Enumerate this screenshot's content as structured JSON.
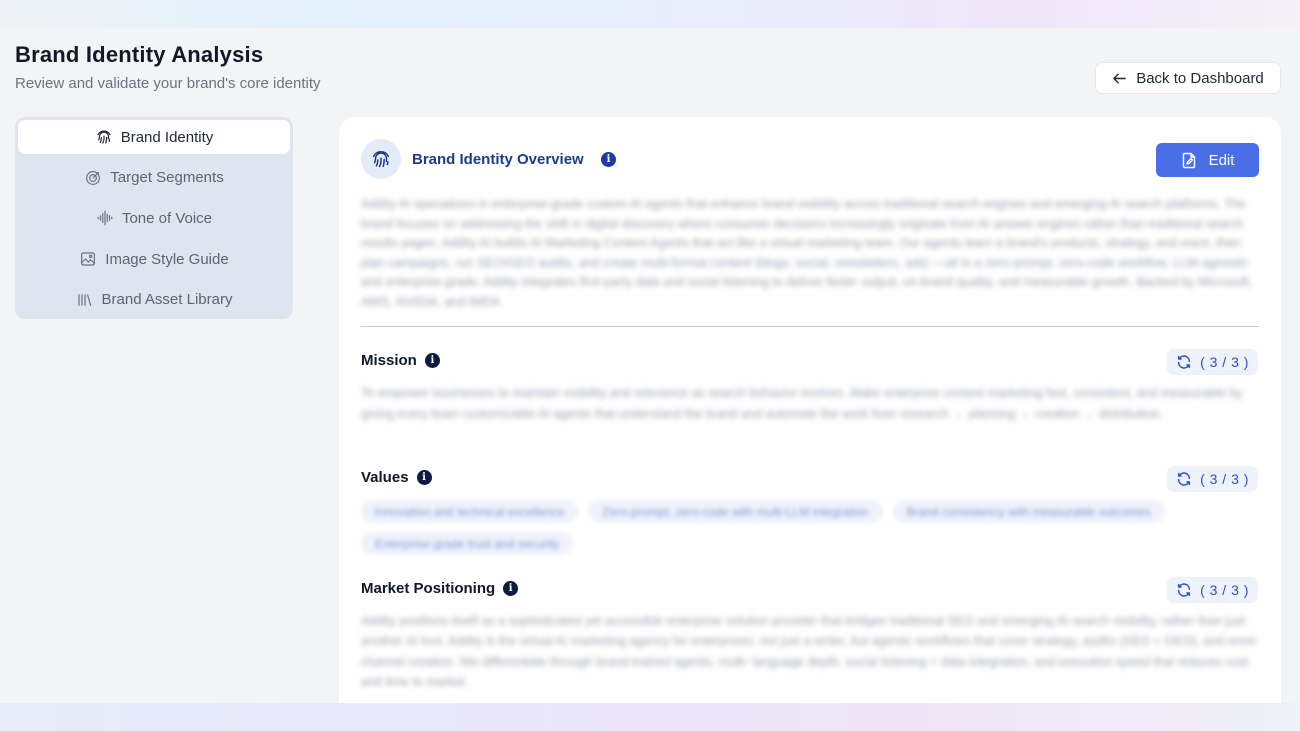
{
  "header": {
    "title": "Brand Identity Analysis",
    "subtitle": "Review and validate your brand's core identity",
    "back_label": "Back to Dashboard"
  },
  "sidebar": {
    "items": [
      {
        "label": "Brand Identity",
        "icon": "fingerprint-icon",
        "active": true
      },
      {
        "label": "Target Segments",
        "icon": "target-icon",
        "active": false
      },
      {
        "label": "Tone of Voice",
        "icon": "audio-wave-icon",
        "active": false
      },
      {
        "label": "Image Style Guide",
        "icon": "image-icon",
        "active": false
      },
      {
        "label": "Brand Asset Library",
        "icon": "library-icon",
        "active": false
      }
    ]
  },
  "overview": {
    "title": "Brand Identity Overview",
    "edit_label": "Edit",
    "text": "Addity AI specializes in enterprise-grade custom AI agents that enhance brand visibility across traditional search engines and emerging AI search platforms. The brand focuses on addressing the shift in digital discovery where consumer decisions increasingly originate from AI answer engines rather than traditional search results pages. Addity AI builds AI Marketing Content Agents that act like a virtual marketing team. Our agents learn a brand's products, strategy, and voice, then plan campaigns, run SEO/GEO audits, and create multi-format content (blogs, social, newsletters, ads) —all in a zero-prompt, zero-code workflow. LLM-agnostic and enterprise-grade, Addity integrates first-party data and social listening to deliver faster output, on-brand quality, and measurable growth. Backed by Microsoft, AWS, NVIDIA, and IMDA"
  },
  "sections": {
    "mission": {
      "title": "Mission",
      "counter": "( 3 / 3 )",
      "text": "To empower businesses to maintain visibility and relevance as search behavior evolves. Make enterprise content marketing fast, consistent, and measurable by giving every team customizable AI agents that understand the brand and automate the work from research → planning → creation → distribution."
    },
    "values": {
      "title": "Values",
      "counter": "( 3 / 3 )",
      "pills": [
        "Innovation and technical excellence",
        "Zero-prompt, zero-code with multi-LLM integration",
        "Brand consistency with measurable outcomes",
        "Enterprise-grade trust and security"
      ]
    },
    "positioning": {
      "title": "Market Positioning",
      "counter": "( 3 / 3 )",
      "text": "Addity positions itself as a sophisticated yet accessible enterprise solution provider that bridges traditional SEO and emerging AI search visibility, rather than just another AI tool. Addity is the virtual AI marketing agency for enterprises: not just a writer, but agentic workflows that cover strategy, audits (SEO + GEO), and omni-channel creation. We differentiate through brand-trained agents, multi- language depth, social listening + data integration, and execution speed that reduces cost and time to market."
    }
  },
  "colors": {
    "accent": "#4a6ee8",
    "title_blue": "#1e3a8a",
    "sidebar_bg": "#dfe5ee"
  }
}
